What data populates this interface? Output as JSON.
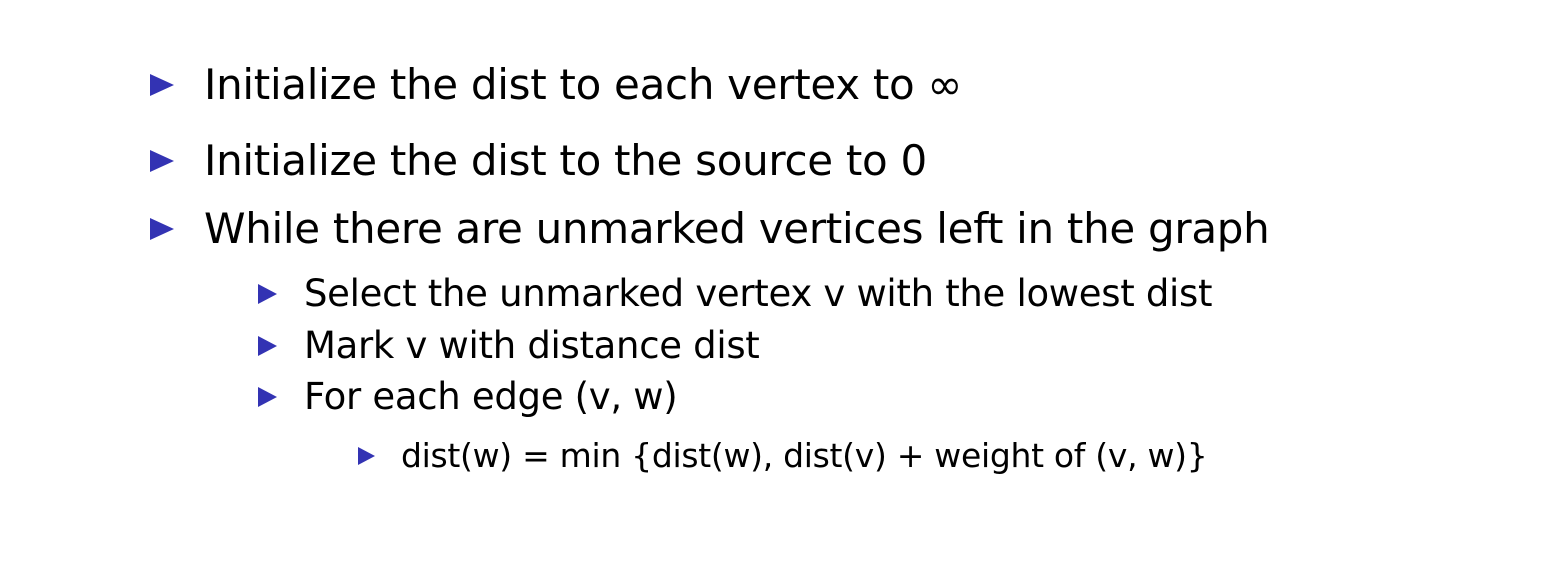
{
  "bullets": {
    "color": "#3333b3"
  },
  "items": [
    {
      "level": 1,
      "text": "Initialize the dist to each vertex to ∞"
    },
    {
      "level": 1,
      "text": "Initialize the dist to the source to 0"
    },
    {
      "level": 1,
      "text": "While there are unmarked vertices left in the graph"
    },
    {
      "level": 2,
      "text": "Select the unmarked vertex v with the lowest dist"
    },
    {
      "level": 2,
      "text": "Mark v with distance dist"
    },
    {
      "level": 2,
      "text": "For each edge (v, w)"
    },
    {
      "level": 3,
      "text": "dist(w) = min {dist(w), dist(v) + weight of (v, w)}"
    }
  ]
}
